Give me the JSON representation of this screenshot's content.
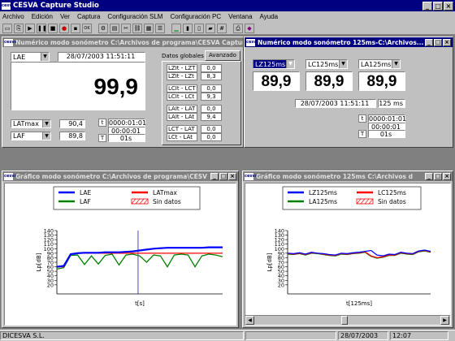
{
  "app": {
    "title": "CESVA Capture Studio"
  },
  "menu": [
    "Archivo",
    "Edición",
    "Ver",
    "Captura",
    "Configuración SLM",
    "Configuración PC",
    "Ventana",
    "Ayuda"
  ],
  "win1": {
    "title": "Numérico modo sonómetro C:\\Archivos de programa\\CESVA Capture",
    "main_param": "LAE",
    "datetime": "28/07/2003 11:51:11",
    "big_value": "99,9",
    "row1_param": "LATmax",
    "row1_value": "90,4",
    "row2_param": "LAF",
    "row2_value": "89,8",
    "t_label": "t",
    "t1": "0000:01:01",
    "t2": "00:00:01",
    "T_label": "T",
    "T_value": "01s",
    "tab_global": "Datos globales",
    "tab_advanced": "Avanzado",
    "advanced": [
      {
        "label": "LZIt - LZT",
        "value": "0,0"
      },
      {
        "label": "LZIt - LZt",
        "value": "8,3"
      },
      {
        "label": "LCIt - LCT",
        "value": "0,0"
      },
      {
        "label": "LCIt - LCt",
        "value": "9,3"
      },
      {
        "label": "LAIt - LAT",
        "value": "0,0"
      },
      {
        "label": "LAIt - LAt",
        "value": "9,4"
      },
      {
        "label": "LCT - LAT",
        "value": "0,0"
      },
      {
        "label": "LCt - LAt",
        "value": "0,0"
      }
    ]
  },
  "win2": {
    "title": "Numérico modo sonómetro 125ms-C:\\Archivos...",
    "params": [
      "LZ125ms",
      "LC125ms",
      "LA125ms"
    ],
    "values": [
      "89,9",
      "89,9",
      "89,9"
    ],
    "datetime": "28/07/2003 11:51:11",
    "period": "125 ms",
    "t_label": "t",
    "t1": "0000:01:01",
    "t2": "00:00:01",
    "T_label": "T",
    "T_value": "01s"
  },
  "win3": {
    "title": "Gráfico modo sonómetro C:\\Archivos de programa\\CESV",
    "legend": [
      {
        "name": "LAE",
        "color": "#0000ff"
      },
      {
        "name": "LATmax",
        "color": "#ff0000"
      },
      {
        "name": "LAF",
        "color": "#008000"
      },
      {
        "name": "Sin datos",
        "color": "#ff0000"
      }
    ],
    "ylabel": "Lp[dB]",
    "xlabel": "t[s]"
  },
  "win4": {
    "title": "Gráfico modo sonómetro 125ms C:\\Archivos d",
    "legend": [
      {
        "name": "LZ125ms",
        "color": "#0000ff"
      },
      {
        "name": "LC125ms",
        "color": "#ff0000"
      },
      {
        "name": "LA125ms",
        "color": "#008000"
      },
      {
        "name": "Sin datos",
        "color": "#ff0000"
      }
    ],
    "ylabel": "Lp[dB]",
    "xlabel": "t[125ms]"
  },
  "chart_data": [
    {
      "type": "line",
      "ylabel": "Lp[dB]",
      "xlabel": "t[s]",
      "ylim": [
        0,
        140
      ],
      "yticks": [
        "140",
        "130",
        "120",
        "110",
        "100",
        "90",
        "80",
        "70",
        "60",
        "50",
        "40",
        "30",
        "20"
      ],
      "series": [
        {
          "name": "LAE",
          "color": "#0000ff",
          "values": [
            60,
            62,
            88,
            90,
            91,
            91,
            91,
            92,
            92,
            92,
            93,
            94,
            96,
            98,
            100,
            101,
            102,
            102,
            102,
            102,
            102,
            102,
            103,
            103,
            103
          ]
        },
        {
          "name": "LATmax",
          "color": "#ff0000",
          "values": [
            60,
            60,
            88,
            90,
            90,
            90,
            90,
            90,
            90,
            90,
            90,
            90,
            90,
            90,
            90,
            90,
            90,
            90,
            90,
            90,
            90,
            90,
            90,
            90,
            90
          ]
        },
        {
          "name": "LAF",
          "color": "#008000",
          "values": [
            55,
            58,
            85,
            86,
            65,
            84,
            66,
            85,
            88,
            64,
            86,
            88,
            84,
            70,
            86,
            84,
            60,
            86,
            88,
            86,
            60,
            84,
            88,
            86,
            82
          ]
        }
      ]
    },
    {
      "type": "line",
      "ylabel": "Lp[dB]",
      "xlabel": "t[125ms]",
      "ylim": [
        0,
        140
      ],
      "yticks": [
        "140",
        "130",
        "120",
        "110",
        "100",
        "90",
        "80",
        "70",
        "60",
        "50",
        "40",
        "30",
        "20"
      ],
      "series": [
        {
          "name": "LZ125ms",
          "color": "#0000ff",
          "values": [
            90,
            89,
            91,
            88,
            92,
            90,
            89,
            87,
            86,
            90,
            89,
            91,
            92,
            94,
            96,
            86,
            84,
            88,
            87,
            92,
            90,
            89,
            95,
            97,
            94
          ]
        },
        {
          "name": "LC125ms",
          "color": "#ff0000",
          "values": [
            89,
            88,
            90,
            87,
            91,
            90,
            88,
            86,
            85,
            89,
            88,
            90,
            91,
            93,
            84,
            80,
            82,
            86,
            86,
            91,
            89,
            88,
            94,
            96,
            93
          ]
        },
        {
          "name": "LA125ms",
          "color": "#008000",
          "values": [
            88,
            87,
            89,
            86,
            90,
            89,
            87,
            85,
            84,
            88,
            87,
            89,
            90,
            92,
            83,
            79,
            81,
            85,
            85,
            90,
            88,
            87,
            93,
            95,
            92
          ]
        }
      ]
    }
  ],
  "status": {
    "company": "DICESVA S.L.",
    "date": "28/07/2003",
    "time": "12:07"
  }
}
